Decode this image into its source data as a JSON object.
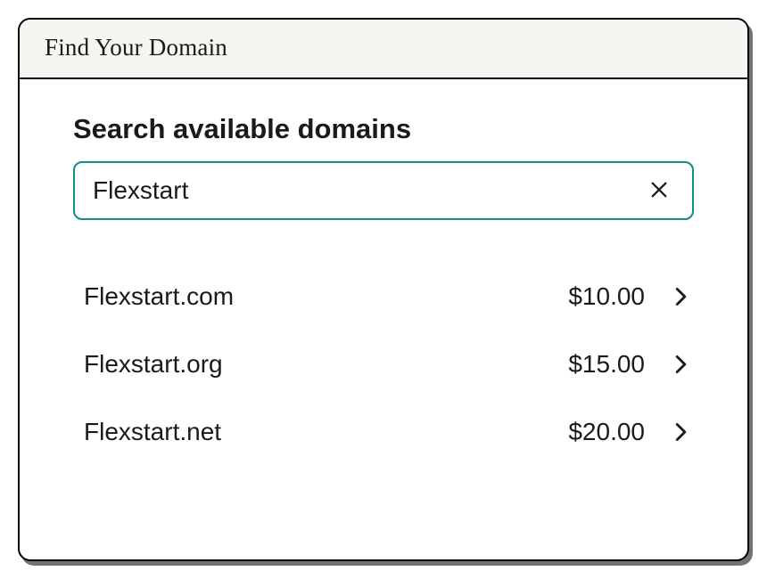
{
  "window": {
    "title": "Find Your Domain"
  },
  "search": {
    "heading": "Search available domains",
    "value": "Flexstart"
  },
  "results": [
    {
      "name": "Flexstart.com",
      "price": "$10.00"
    },
    {
      "name": "Flexstart.org",
      "price": "$15.00"
    },
    {
      "name": "Flexstart.net",
      "price": "$20.00"
    }
  ],
  "colors": {
    "accent": "#0f8d88",
    "border": "#000000",
    "titlebar_bg": "#f7f5f1"
  }
}
